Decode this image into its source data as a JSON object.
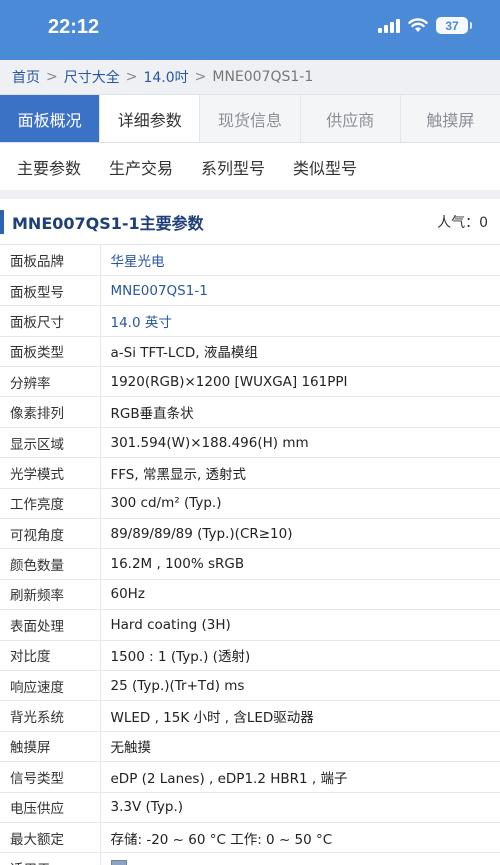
{
  "status_bar": {
    "time": "22:12",
    "battery": "37",
    "accent": "#4a8ad6"
  },
  "breadcrumb": [
    "首页",
    "尺寸大全",
    "14.0吋",
    "MNE007QS1-1"
  ],
  "main_tabs": [
    "面板概况",
    "详细参数",
    "现货信息",
    "供应商",
    "触摸屏"
  ],
  "sub_tabs": [
    "主要参数",
    "生产交易",
    "系列型号",
    "类似型号"
  ],
  "section": {
    "title": "MNE007QS1-1主要参数",
    "popularity": "人气：0"
  },
  "rows": [
    {
      "label": "面板品牌",
      "value": "华星光电"
    },
    {
      "label": "面板型号",
      "value": "MNE007QS1-1"
    },
    {
      "label": "面板尺寸",
      "value": "14.0 英寸"
    },
    {
      "label": "面板类型",
      "value": "a-Si TFT-LCD, 液晶模组"
    },
    {
      "label": "分辨率",
      "value": "1920(RGB)×1200  [WUXGA]  161PPI"
    },
    {
      "label": "像素排列",
      "value": "RGB垂直条状"
    },
    {
      "label": "显示区域",
      "value": "301.594(W)×188.496(H) mm"
    },
    {
      "label": "光学模式",
      "value": "FFS,  常黑显示,  透射式"
    },
    {
      "label": "工作亮度",
      "value": "300 cd/m² (Typ.)"
    },
    {
      "label": "可视角度",
      "value": "89/89/89/89 (Typ.)(CR≥10)"
    },
    {
      "label": "颜色数量",
      "value": "16.2M , 100% sRGB"
    },
    {
      "label": "刷新频率",
      "value": "60Hz"
    },
    {
      "label": "表面处理",
      "value": "Hard coating (3H)"
    },
    {
      "label": "对比度",
      "value": "1500 : 1 (Typ.) (透射)"
    },
    {
      "label": "响应速度",
      "value": "25 (Typ.)(Tr+Td) ms"
    },
    {
      "label": "背光系统",
      "value": "WLED , 15K 小时 , 含LED驱动器"
    },
    {
      "label": "触摸屏",
      "value": "无触摸"
    },
    {
      "label": "信号类型",
      "value": "eDP (2 Lanes) , eDP1.2 HBR1 , 端子"
    },
    {
      "label": "电压供应",
      "value": "3.3V (Typ.)"
    },
    {
      "label": "最大额定",
      "value": "存储: -20 ~ 60 °C    工作: 0 ~ 50 °C"
    },
    {
      "label": "适用于",
      "value": ""
    }
  ]
}
